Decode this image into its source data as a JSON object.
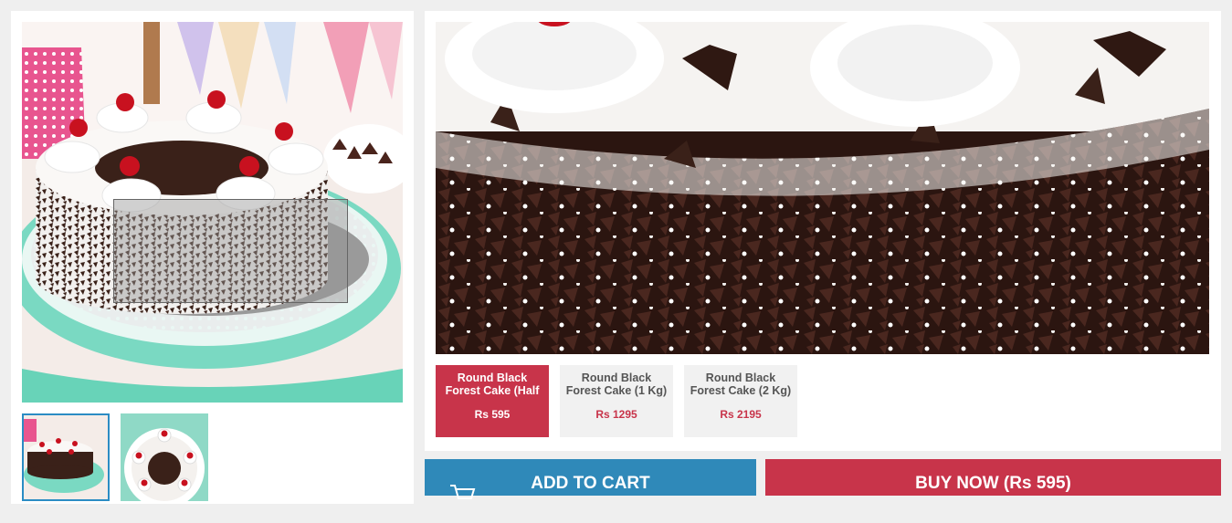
{
  "gallery": {
    "main_image": "black-forest-cake-photo",
    "thumbnails": [
      "black-forest-cake-side-thumbnail",
      "black-forest-cake-top-thumbnail"
    ]
  },
  "variants": [
    {
      "name": "Round Black Forest Cake (Half Kg)",
      "price": "Rs 595",
      "selected": true
    },
    {
      "name": "Round Black Forest Cake (1 Kg)",
      "price": "Rs 1295",
      "selected": false
    },
    {
      "name": "Round Black Forest Cake (2 Kg)",
      "price": "Rs 2195",
      "selected": false
    }
  ],
  "actions": {
    "add_to_cart": "ADD TO CART",
    "buy_now": "BUY NOW (Rs 595)",
    "cart_icon": "cart-icon"
  },
  "colors": {
    "accent_red": "#c8344a",
    "cart_blue": "#2f89b9",
    "selected_thumb_border": "#2b8cc4"
  }
}
